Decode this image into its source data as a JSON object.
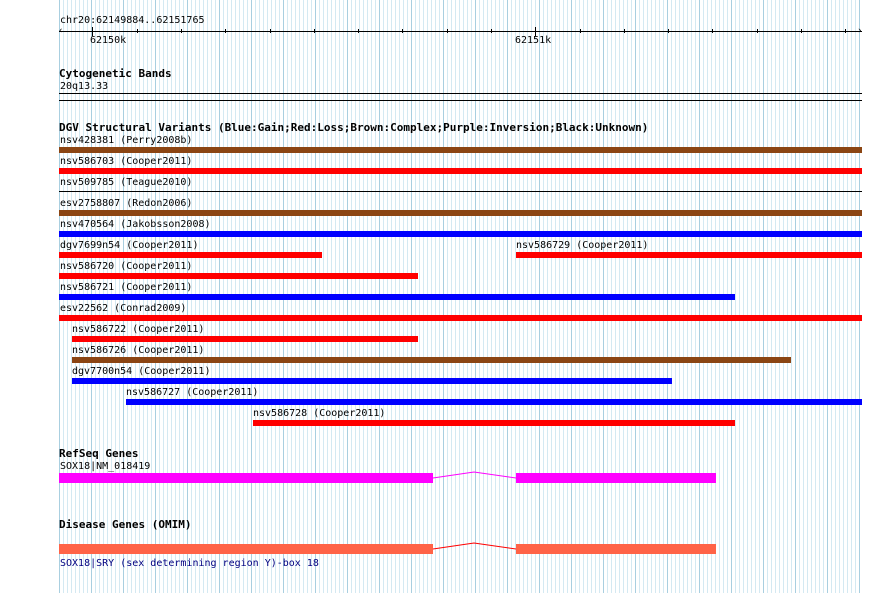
{
  "ruler": {
    "location": "chr20:62149884..62151765",
    "label_left": "62150k",
    "label_right": "62151k"
  },
  "cytoband": {
    "title": "Cytogenetic Bands",
    "band": "20q13.33"
  },
  "dgv": {
    "title": "DGV Structural Variants (Blue:Gain;Red:Loss;Brown:Complex;Purple:Inversion;Black:Unknown)",
    "colors": {
      "gain": "#0000ff",
      "loss": "#ff0000",
      "complex": "#8b4513",
      "unknown": "#000000"
    },
    "variants": [
      {
        "label": "nsv428381 (Perry2008b)",
        "type": "complex"
      },
      {
        "label": "nsv586703 (Cooper2011)",
        "type": "loss"
      },
      {
        "label": "nsv509785 (Teague2010)",
        "type": "unknown"
      },
      {
        "label": "esv2758807 (Redon2006)",
        "type": "complex"
      },
      {
        "label": "nsv470564 (Jakobsson2008)",
        "type": "gain"
      },
      {
        "label": "dgv7699n54 (Cooper2011)",
        "type": "loss"
      },
      {
        "label": "nsv586729 (Cooper2011)",
        "type": "loss"
      },
      {
        "label": "nsv586720 (Cooper2011)",
        "type": "loss"
      },
      {
        "label": "nsv586721 (Cooper2011)",
        "type": "gain"
      },
      {
        "label": "esv22562 (Conrad2009)",
        "type": "loss"
      },
      {
        "label": "nsv586722 (Cooper2011)",
        "type": "loss"
      },
      {
        "label": "nsv586726 (Cooper2011)",
        "type": "complex"
      },
      {
        "label": "dgv7700n54 (Cooper2011)",
        "type": "gain"
      },
      {
        "label": "nsv586727 (Cooper2011)",
        "type": "gain"
      },
      {
        "label": "nsv586728 (Cooper2011)",
        "type": "loss"
      }
    ]
  },
  "refseq": {
    "title": "RefSeq Genes",
    "gene_label": "SOX18|NM_018419",
    "color": "#ff00ff"
  },
  "omim": {
    "title": "Disease Genes (OMIM)",
    "gene_label": "SOX18|SRY (sex determining region Y)-box 18",
    "color": "#ff6347",
    "label_color": "#000080"
  }
}
